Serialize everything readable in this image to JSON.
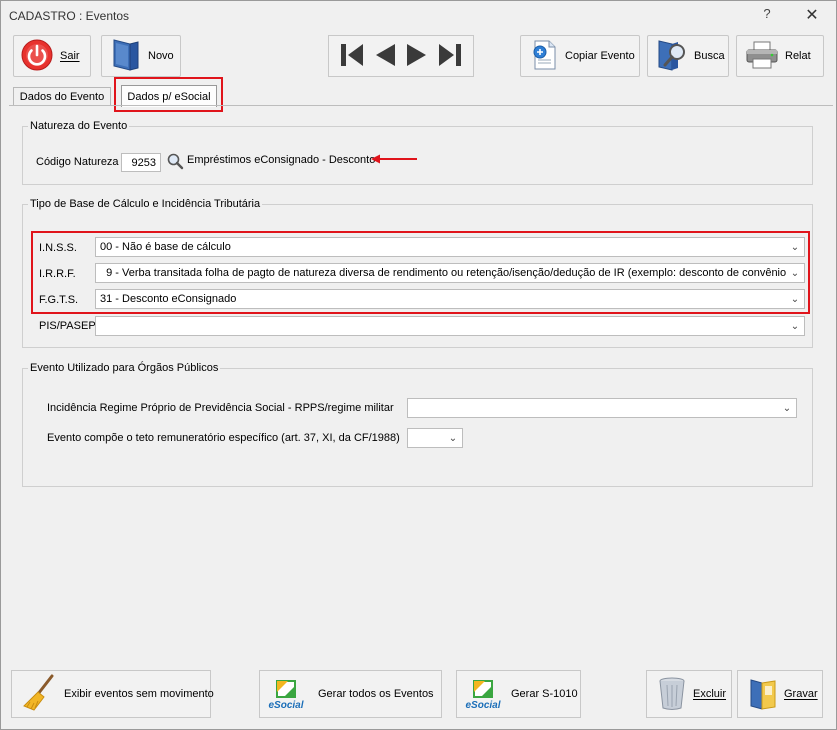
{
  "window": {
    "title": "CADASTRO : Eventos",
    "help_label": "?",
    "close_label": "✕"
  },
  "toolbar": {
    "sair_label": "Sair",
    "novo_label": "Novo",
    "copiar_label": "Copiar Evento",
    "busca_label": "Busca",
    "relat_label": "Relat"
  },
  "tabs": [
    {
      "label": "Dados do Evento"
    },
    {
      "label": "Dados p/ eSocial"
    }
  ],
  "natureza": {
    "group_title": "Natureza do Evento",
    "codigo_label": "Código Natureza",
    "codigo_value": "9253",
    "descricao": "Empréstimos eConsignado - Desconto"
  },
  "tipo_base": {
    "group_title": "Tipo de Base de Cálculo e Incidência Tributária",
    "rows": [
      {
        "label": "I.N.S.S.",
        "value": "00 - Não é base de cálculo"
      },
      {
        "label": "I.R.R.F.",
        "value": "  9 - Verba transitada folha de pagto de natureza diversa de rendimento ou retenção/isenção/dedução de IR (exemplo: desconto de convênio"
      },
      {
        "label": "F.G.T.S.",
        "value": "31 - Desconto eConsignado"
      },
      {
        "label": "PIS/PASEP",
        "value": ""
      }
    ]
  },
  "orgaos": {
    "group_title": "Evento Utilizado para Órgãos Públicos",
    "rpps_label": "Incidência Regime Próprio de Previdência Social - RPPS/regime militar",
    "rpps_value": "",
    "teto_label": "Evento compõe o teto remuneratório específico (art. 37, XI, da CF/1988)",
    "teto_value": ""
  },
  "bottom": {
    "exibir_label": "Exibir eventos sem movimento",
    "gerar_todos_label": "Gerar todos os Eventos",
    "gerar_s1010_label": "Gerar S-1010",
    "excluir_label": "Excluir",
    "gravar_label": "Gravar",
    "esocial_brand": "eSocial"
  },
  "colors": {
    "highlight_red": "#e0141b",
    "window_bg": "#f0f0f0"
  }
}
